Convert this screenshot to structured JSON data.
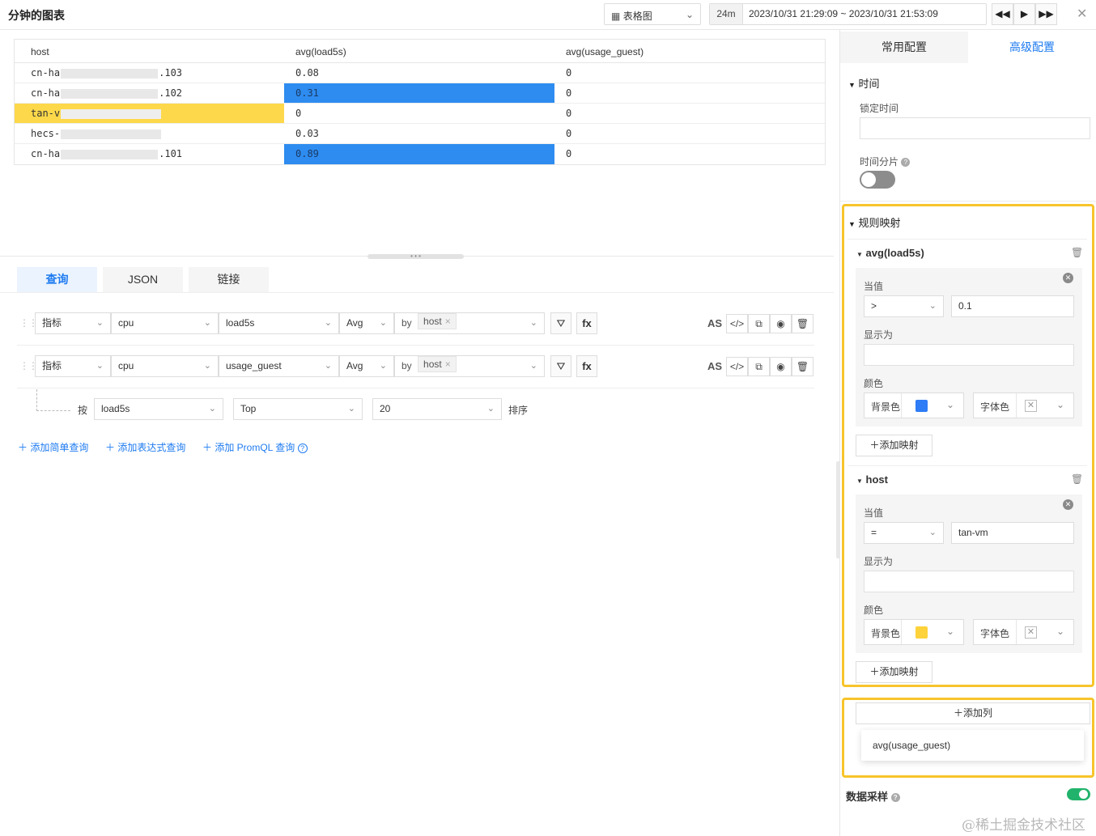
{
  "header": {
    "title": "分钟的图表",
    "chart_type": "表格图",
    "relative_range": "24m",
    "time_range": "2023/10/31 21:29:09 ~ 2023/10/31 21:53:09"
  },
  "table": {
    "columns": [
      "host",
      "avg(load5s)",
      "avg(usage_guest)"
    ],
    "rows": [
      {
        "host_prefix": "cn-ha",
        "host_suffix": ".103",
        "load5s": "0.08",
        "usage_guest": "0"
      },
      {
        "host_prefix": "cn-ha",
        "host_suffix": ".102",
        "load5s": "0.31",
        "usage_guest": "0"
      },
      {
        "host_prefix": "tan-v",
        "host_suffix": "",
        "load5s": "0",
        "usage_guest": "0"
      },
      {
        "host_prefix": "hecs-",
        "host_suffix": "",
        "load5s": "0.03",
        "usage_guest": "0"
      },
      {
        "host_prefix": "cn-ha",
        "host_suffix": ".101",
        "load5s": "0.89",
        "usage_guest": "0"
      }
    ],
    "highlight_blue": "#2e8cf0",
    "highlight_yellow": "#fdd84a"
  },
  "query_tabs": [
    "查询",
    "JSON",
    "链接"
  ],
  "queries": [
    {
      "type": "指标",
      "measurement": "cpu",
      "field": "load5s",
      "agg": "Avg",
      "by": "by",
      "tag": "host"
    },
    {
      "type": "指标",
      "measurement": "cpu",
      "field": "usage_guest",
      "agg": "Avg",
      "by": "by",
      "tag": "host"
    }
  ],
  "query_actions": {
    "filter": "⛛",
    "fx": "fx",
    "as": "AS",
    "code": "</>"
  },
  "sort": {
    "prefix": "按",
    "field": "load5s",
    "order": "Top",
    "limit": "20",
    "suffix": "排序"
  },
  "add_links": [
    "添加简单查询",
    "添加表达式查询",
    "添加 PromQL 查询"
  ],
  "right_panel": {
    "tabs": [
      "常用配置",
      "高级配置"
    ],
    "time_section": "时间",
    "lock_time_label": "锁定时间",
    "time_slice_label": "时间分片",
    "rule_mapping_title": "规则映射",
    "mappings": [
      {
        "column": "avg(load5s)",
        "when_label": "当值",
        "operator": ">",
        "value": "0.1",
        "display_label": "显示为",
        "color_label": "颜色",
        "bg_label": "背景色",
        "bg_color": "#2e7cf6",
        "font_label": "字体色",
        "add_label": "添加映射"
      },
      {
        "column": "host",
        "when_label": "当值",
        "operator": "=",
        "value": "tan-vm",
        "display_label": "显示为",
        "color_label": "颜色",
        "bg_label": "背景色",
        "bg_color": "#fdd23a",
        "font_label": "字体色",
        "add_label": "添加映射"
      }
    ],
    "add_column_label": "添加列",
    "column_option": "avg(usage_guest)",
    "sampling_label": "数据采样",
    "accent": "#1e7bf0",
    "highlight_border": "#f7c42b"
  },
  "watermark": "@稀土掘金技术社区"
}
